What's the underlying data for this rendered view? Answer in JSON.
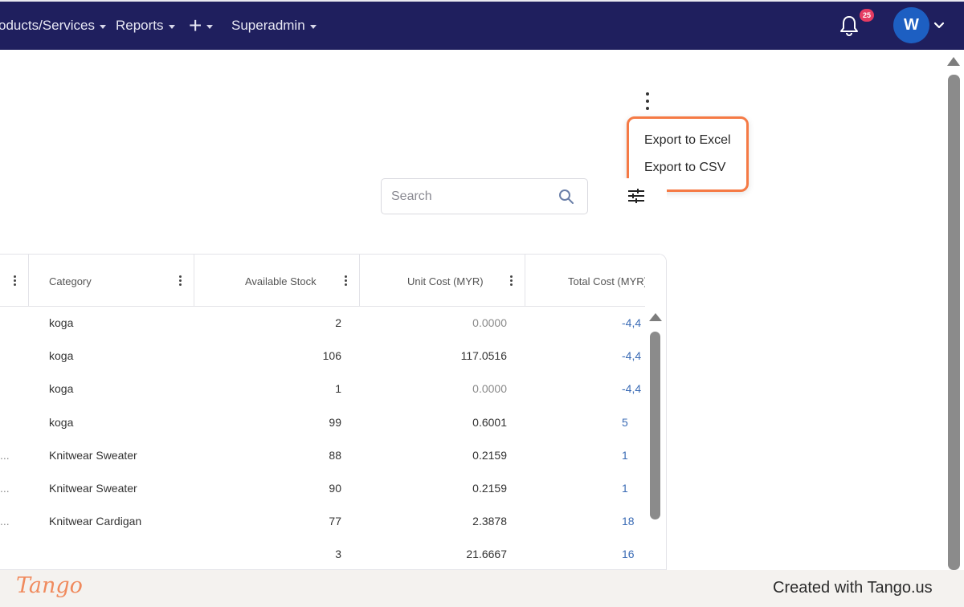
{
  "navbar": {
    "items": [
      {
        "label": "oducts/Services"
      },
      {
        "label": "Reports"
      },
      {
        "label": "+"
      },
      {
        "label": "Superadmin"
      }
    ],
    "notification_count": "25",
    "avatar_initial": "W",
    "bg_color": "#1f1f5e"
  },
  "export_menu": {
    "items": [
      "Export to Excel",
      "Export to CSV"
    ],
    "highlight_color": "#f57a45"
  },
  "search": {
    "placeholder": "Search"
  },
  "table": {
    "columns": [
      "Category",
      "Available Stock",
      "Unit Cost (MYR)",
      "Total Cost (MYR)"
    ],
    "rows": [
      {
        "lead": "",
        "category": "koga",
        "stock": "2",
        "unit_cost": "0.0000",
        "total": "-4,4"
      },
      {
        "lead": "",
        "category": "koga",
        "stock": "106",
        "unit_cost": "117.0516",
        "total": "-4,4"
      },
      {
        "lead": "",
        "category": "koga",
        "stock": "1",
        "unit_cost": "0.0000",
        "total": "-4,4"
      },
      {
        "lead": "",
        "category": "koga",
        "stock": "99",
        "unit_cost": "0.6001",
        "total": "5"
      },
      {
        "lead": "...",
        "category": "Knitwear Sweater",
        "stock": "88",
        "unit_cost": "0.2159",
        "total": "1"
      },
      {
        "lead": "...",
        "category": "Knitwear Sweater",
        "stock": "90",
        "unit_cost": "0.2159",
        "total": "1"
      },
      {
        "lead": "...",
        "category": "Knitwear Cardigan",
        "stock": "77",
        "unit_cost": "2.3878",
        "total": "18"
      },
      {
        "lead": "",
        "category": "",
        "stock": "3",
        "unit_cost": "21.6667",
        "total": "16"
      }
    ]
  },
  "footer": {
    "logo": "Tango",
    "created_with": "Created with Tango.us"
  }
}
